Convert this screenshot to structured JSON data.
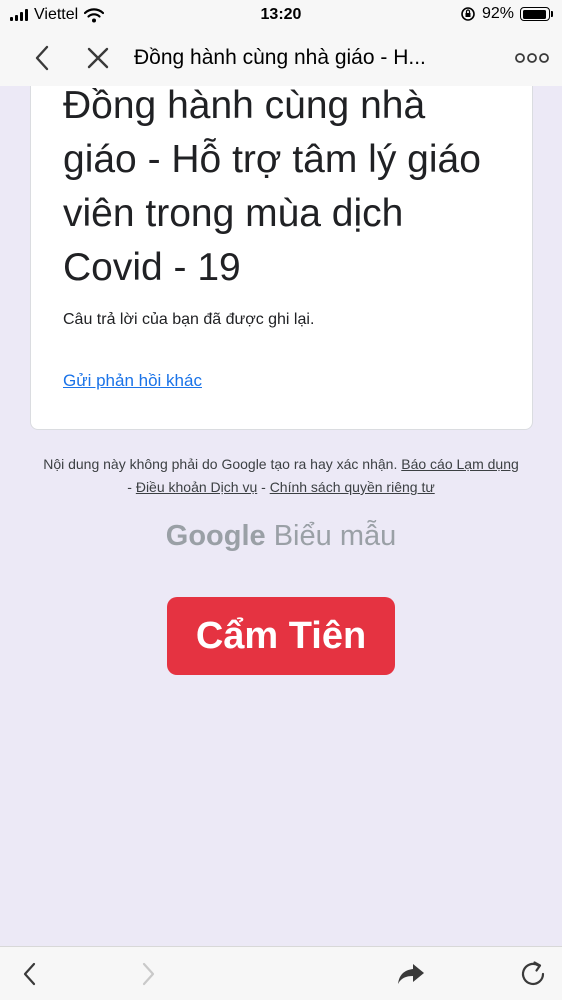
{
  "status_bar": {
    "carrier": "Viettel",
    "time": "13:20",
    "battery": "92%",
    "battery_level": 0.92
  },
  "nav": {
    "title": "Đồng hành cùng nhà giáo - H..."
  },
  "form": {
    "title": "Đồng hành cùng nhà giáo - Hỗ trợ tâm lý giáo viên trong mùa dịch Covid - 19",
    "confirmation": "Câu trả lời của bạn đã được ghi lại.",
    "another_response": "Gửi phản hồi khác"
  },
  "footer": {
    "disclaimer": "Nội dung này không phải do Google tạo ra hay xác nhận.",
    "report_abuse": "Báo cáo Lạm dụng",
    "sep1": " - ",
    "terms": "Điều khoản Dịch vụ",
    "sep2": " - ",
    "privacy": "Chính sách quyền riêng tư",
    "brand_google": "Google",
    "brand_forms": "Biểu mẫu"
  },
  "badge": {
    "name": "Cẩm Tiên",
    "color": "#e53341"
  },
  "icons": {
    "wifi": "wifi-icon",
    "orientation_lock": "orientation-lock-icon",
    "back": "chevron-left-icon",
    "close": "close-icon",
    "more": "more-icon",
    "forward": "chevron-right-icon",
    "share": "share-arrow-icon",
    "reload": "reload-icon"
  }
}
